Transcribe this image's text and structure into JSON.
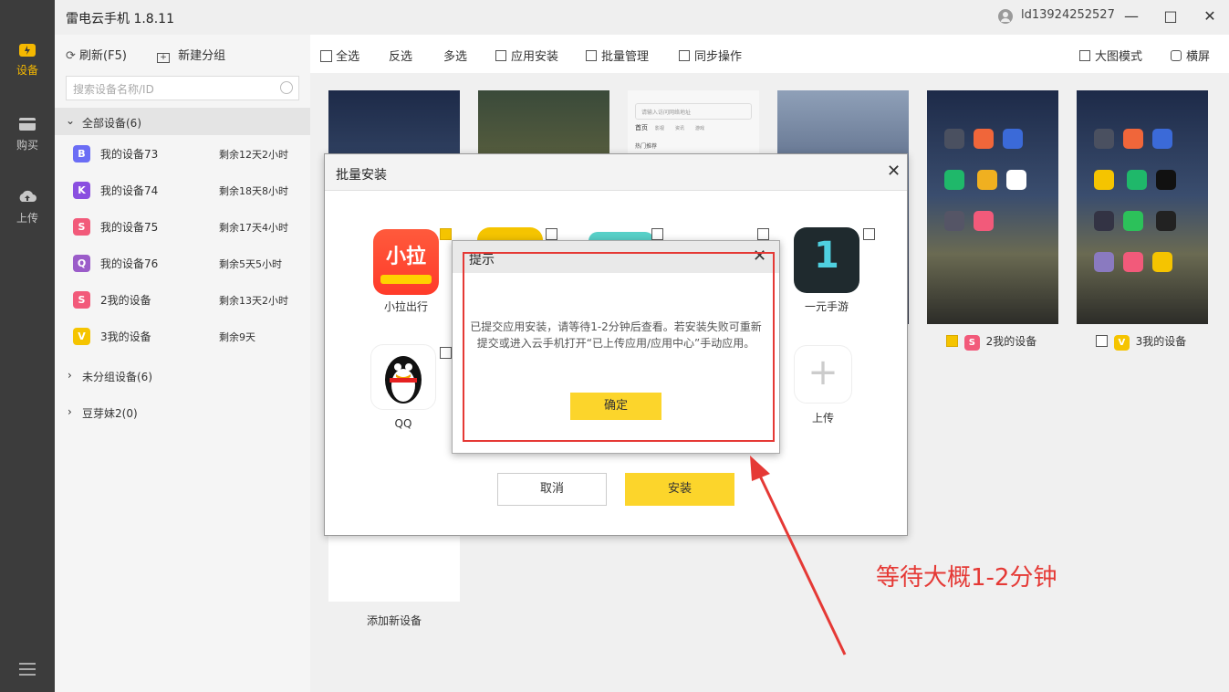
{
  "app": {
    "title": "雷电云手机 1.8.11",
    "user": "ld13924252527"
  },
  "rail": [
    {
      "label": "设备",
      "icon": "device-icon",
      "active": true
    },
    {
      "label": "购买",
      "icon": "wallet-icon",
      "active": false
    },
    {
      "label": "上传",
      "icon": "cloud-upload-icon",
      "active": false
    }
  ],
  "sidebar": {
    "refresh_label": "刷新(F5)",
    "new_group_label": "新建分组",
    "search_placeholder": "搜索设备名称/ID",
    "groups": {
      "all": "全部设备(6)",
      "ungrouped": "未分组设备(6)",
      "douyamei": "豆芽妹2(0)"
    },
    "devices": [
      {
        "badge": "B",
        "color": "#6b6df5",
        "name": "我的设备73",
        "remaining": "剩余12天2小时"
      },
      {
        "badge": "K",
        "color": "#8a4fe0",
        "name": "我的设备74",
        "remaining": "剩余18天8小时"
      },
      {
        "badge": "S",
        "color": "#f25a7a",
        "name": "我的设备75",
        "remaining": "剩余17天4小时"
      },
      {
        "badge": "Q",
        "color": "#9b5cc9",
        "name": "我的设备76",
        "remaining": "剩余5天5小时"
      },
      {
        "badge": "S",
        "color": "#f25a7a",
        "name": "2我的设备",
        "remaining": "剩余13天2小时"
      },
      {
        "badge": "V",
        "color": "#f5c400",
        "name": "3我的设备",
        "remaining": "剩余9天"
      }
    ]
  },
  "toolbar": {
    "select_all": "全选",
    "invert": "反选",
    "multi": "多选",
    "app_install": "应用安装",
    "batch_manage": "批量管理",
    "sync_op": "同步操作",
    "large_mode": "大图模式",
    "landscape": "横屏"
  },
  "devices_grid": {
    "card_2": {
      "name": "2我的设备",
      "checked": true
    },
    "card_3": {
      "name": "3我的设备",
      "checked": false
    },
    "add_label": "添加新设备",
    "search_bar_text": "请输入访问网络地址",
    "browser_tabs": [
      "首页",
      "影视",
      "资讯",
      "游戏",
      "热门推荐"
    ]
  },
  "batch_dialog": {
    "title": "批量安装",
    "apps": [
      {
        "name": "小拉出行",
        "checked": true,
        "icon": "xiaola-app-icon"
      },
      {
        "name": "一元手游",
        "checked": false,
        "icon": "yiyuan-game-icon"
      },
      {
        "name": "QQ",
        "checked": false,
        "icon": "qq-penguin-icon"
      },
      {
        "name": "上传",
        "checked": false,
        "icon": "plus-icon"
      }
    ],
    "cancel_label": "取消",
    "install_label": "安装"
  },
  "tip_dialog": {
    "title": "提示",
    "message": "已提交应用安装，请等待1-2分钟后查看。若安装失败可重新提交或进入云手机打开“已上传应用/应用中心”手动应用。",
    "ok_label": "确定"
  },
  "annotation": {
    "text": "等待大概1-2分钟",
    "color": "#e53935"
  }
}
